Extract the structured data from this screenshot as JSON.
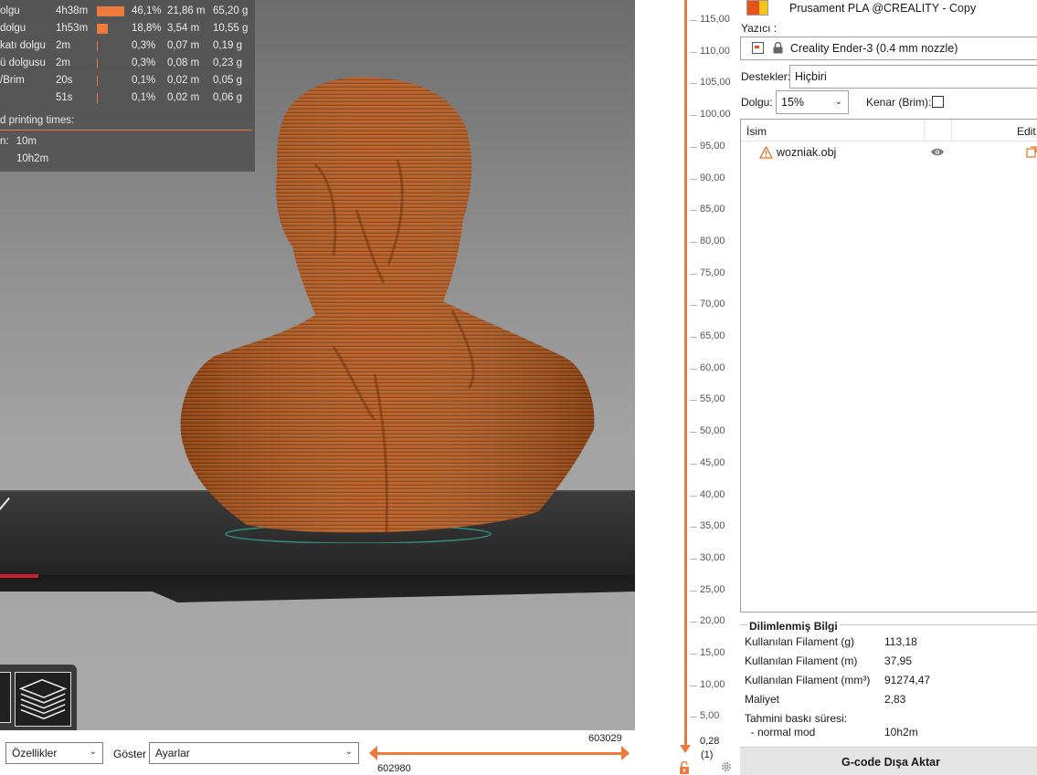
{
  "stats_overlay": {
    "rows": [
      {
        "feature": "olgu",
        "time": "4h38m",
        "bar_fraction": 0.461,
        "percent": "46,1%",
        "length": "21,86 m",
        "weight": "65,20 g"
      },
      {
        "feature": "dolgu",
        "time": "1h53m",
        "bar_fraction": 0.188,
        "percent": "18,8%",
        "length": "3,54 m",
        "weight": "10,55 g"
      },
      {
        "feature": "katı dolgu",
        "time": "2m",
        "bar_fraction": 0.003,
        "percent": "0,3%",
        "length": "0,07 m",
        "weight": "0,19 g"
      },
      {
        "feature": "ü dolgusu",
        "time": "2m",
        "bar_fraction": 0.003,
        "percent": "0,3%",
        "length": "0,08 m",
        "weight": "0,23 g"
      },
      {
        "feature": "/Brim",
        "time": "20s",
        "bar_fraction": 0.001,
        "percent": "0,1%",
        "length": "0,02 m",
        "weight": "0,05 g"
      },
      {
        "feature": "",
        "time": "51s",
        "bar_fraction": 0.001,
        "percent": "0,1%",
        "length": "0,02 m",
        "weight": "0,06 g"
      }
    ],
    "note": "d printing times:",
    "estimated_label": "n:",
    "estimated_value": "10m",
    "total_time": "10h2m",
    "accent_color": "#ec7a3d"
  },
  "bottom_bar": {
    "features_select": "Özellikler",
    "show_label": "Göster",
    "show_select": "Ayarlar",
    "h_slider_max": "603029",
    "h_slider_min": "602980"
  },
  "layer_slider": {
    "ticks": [
      "115,00",
      "110,00",
      "105,00",
      "100,00",
      "95,00",
      "90,00",
      "85,00",
      "80,00",
      "75,00",
      "70,00",
      "65,00",
      "60,00",
      "55,00",
      "50,00",
      "45,00",
      "40,00",
      "35,00",
      "30,00",
      "25,00",
      "20,00",
      "15,00",
      "10,00",
      "5,00"
    ],
    "bottom_value": "0,28",
    "bottom_index": "(1)"
  },
  "sidebar": {
    "filament_name": "Prusament PLA @CREALITY - Copy",
    "filament_colors": [
      "#e8531d",
      "#f4c419"
    ],
    "printer_label": "Yazıcı :",
    "printer_name": "Creality Ender-3 (0.4 mm nozzle)",
    "supports_label": "Destekler:",
    "supports_value": "Hiçbiri",
    "infill_label": "Dolgu:",
    "infill_value": "15%",
    "brim_label": "Kenar (Brim):",
    "brim_checked": false,
    "object_list": {
      "name_header": "İsim",
      "edit_header": "Edit",
      "objects": [
        {
          "name": "wozniak.obj",
          "warning": true,
          "visible": true
        }
      ]
    },
    "sliced_info": {
      "title": "Dilimlenmiş Bilgi",
      "rows": [
        {
          "key": "Kullanılan Filament (g)",
          "value": "113,18"
        },
        {
          "key": "Kullanılan Filament (m)",
          "value": "37,95"
        },
        {
          "key": "Kullanılan Filament (mm³)",
          "value": "91274,47"
        },
        {
          "key": "Maliyet",
          "value": "2,83"
        },
        {
          "key": "Tahmini baskı süresi:",
          "value": ""
        },
        {
          "key": "  - normal mod",
          "value": "10h2m"
        }
      ]
    },
    "export_button": "G-code Dışa Aktar"
  }
}
